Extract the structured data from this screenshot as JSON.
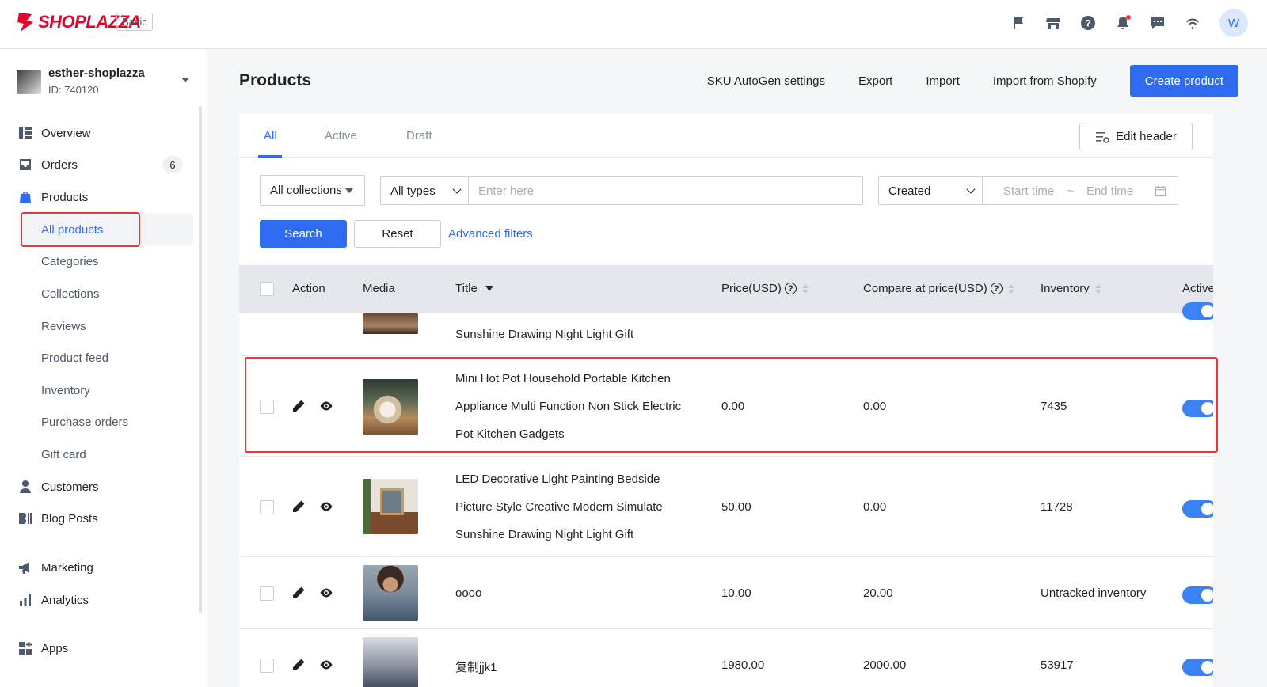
{
  "brand": {
    "name": "SHOPLAZZA",
    "plan": "Basic",
    "color": "#e4002b"
  },
  "topbar": {
    "icons": [
      "flag-icon",
      "store-icon",
      "help-icon",
      "bell-icon",
      "message-icon",
      "wifi-icon"
    ],
    "avatar_initial": "W"
  },
  "store": {
    "name": "esther-shoplazza",
    "id": "ID: 740120"
  },
  "nav": {
    "overview": "Overview",
    "orders": "Orders",
    "orders_count": "6",
    "products": "Products",
    "all_products": "All products",
    "categories": "Categories",
    "collections": "Collections",
    "reviews": "Reviews",
    "product_feed": "Product feed",
    "inventory": "Inventory",
    "purchase_orders": "Purchase orders",
    "gift_card": "Gift card",
    "customers": "Customers",
    "blog_posts": "Blog Posts",
    "marketing": "Marketing",
    "analytics": "Analytics",
    "apps": "Apps"
  },
  "page": {
    "title": "Products",
    "sku_autogen": "SKU AutoGen settings",
    "export": "Export",
    "import": "Import",
    "import_shopify": "Import from Shopify",
    "create": "Create product"
  },
  "tabs": {
    "all": "All",
    "active": "Active",
    "draft": "Draft",
    "edit_header": "Edit header"
  },
  "filters": {
    "collections": "All collections",
    "types": "All types",
    "search_placeholder": "Enter here",
    "date_field": "Created",
    "start_time": "Start time",
    "separator": "~",
    "end_time": "End time",
    "search": "Search",
    "reset": "Reset",
    "advanced": "Advanced filters"
  },
  "table": {
    "headers": {
      "action": "Action",
      "media": "Media",
      "title": "Title",
      "price": "Price(USD)",
      "compare": "Compare at price(USD)",
      "inventory": "Inventory",
      "active": "Active"
    },
    "partial_row_title": "Sunshine Drawing Night Light Gift",
    "rows": [
      {
        "title_lines": [
          "Mini Hot Pot Household Portable Kitchen",
          "Appliance Multi Function Non Stick Electric",
          "Pot Kitchen Gadgets"
        ],
        "price": "0.00",
        "compare": "0.00",
        "inventory": "7435",
        "active": true
      },
      {
        "title_lines": [
          "LED Decorative Light Painting Bedside",
          "Picture Style Creative Modern Simulate",
          "Sunshine Drawing Night Light Gift"
        ],
        "price": "50.00",
        "compare": "0.00",
        "inventory": "11728",
        "active": true
      },
      {
        "title_lines": [
          "oooo"
        ],
        "price": "10.00",
        "compare": "20.00",
        "inventory": "Untracked inventory",
        "active": true
      },
      {
        "title_lines": [
          "复制jjk1"
        ],
        "price": "1980.00",
        "compare": "2000.00",
        "inventory": "53917",
        "active": true
      }
    ]
  },
  "colors": {
    "accent": "#2f6bf0",
    "highlight": "#e5383b",
    "toggle_on": "#3b82f6"
  }
}
